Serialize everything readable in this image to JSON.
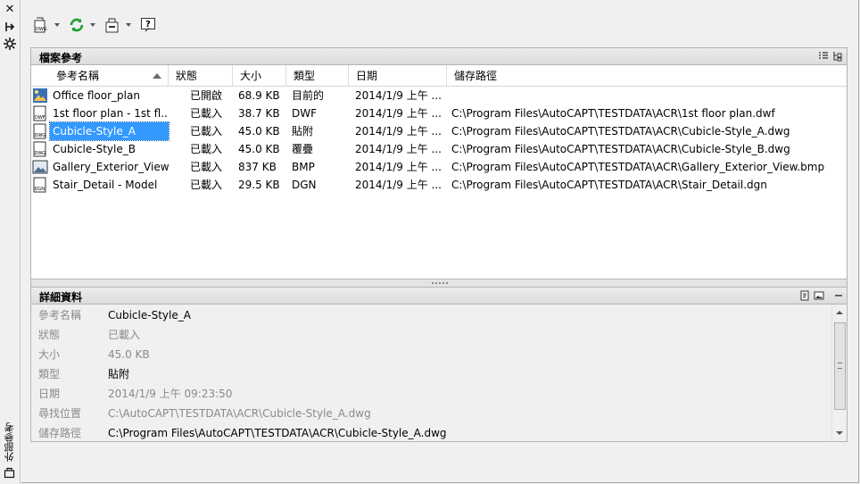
{
  "palette": {
    "title": "外部參考",
    "icons": [
      "close-icon",
      "autohide-icon",
      "properties-icon",
      "palette-menu-icon"
    ]
  },
  "toolbar": {
    "buttons": [
      {
        "name": "attach-dwg-button",
        "icon": "attach-dwg-icon",
        "label": "DWG"
      },
      {
        "name": "refresh-button",
        "icon": "refresh-icon"
      },
      {
        "name": "change-path-button",
        "icon": "change-path-icon"
      },
      {
        "name": "help-button",
        "icon": "help-icon"
      }
    ]
  },
  "file_refs": {
    "title": "檔案參考",
    "view_icons": [
      "list-view-icon",
      "tree-view-icon"
    ],
    "columns": [
      "參考名稱",
      "狀態",
      "大小",
      "類型",
      "日期",
      "儲存路徑"
    ],
    "sort_column": "參考名稱",
    "rows": [
      {
        "icon": "drawing-icon",
        "name": "Office floor_plan",
        "status": "已開啟",
        "size": "68.9 KB",
        "type": "目前的",
        "date": "2014/1/9 上午 ...",
        "path": ""
      },
      {
        "icon": "dwf-icon",
        "icon_label": "DWF",
        "name": "1st floor plan - 1st fl...",
        "status": "已載入",
        "size": "38.7 KB",
        "type": "DWF",
        "date": "2014/1/9 上午 ...",
        "path": "C:\\Program Files\\AutoCAPT\\TESTDATA\\ACR\\1st floor plan.dwf"
      },
      {
        "icon": "dwg-icon",
        "icon_label": "DWG",
        "name": "Cubicle-Style_A",
        "status": "已載入",
        "size": "45.0 KB",
        "type": "貼附",
        "date": "2014/1/9 上午 ...",
        "path": "C:\\Program Files\\AutoCAPT\\TESTDATA\\ACR\\Cubicle-Style_A.dwg",
        "selected": true
      },
      {
        "icon": "dwg-icon",
        "icon_label": "DWG",
        "name": "Cubicle-Style_B",
        "status": "已載入",
        "size": "45.0 KB",
        "type": "覆疊",
        "date": "2014/1/9 上午 ...",
        "path": "C:\\Program Files\\AutoCAPT\\TESTDATA\\ACR\\Cubicle-Style_B.dwg"
      },
      {
        "icon": "image-icon",
        "name": "Gallery_Exterior_View",
        "status": "已載入",
        "size": "837 KB",
        "type": "BMP",
        "date": "2014/1/9 上午 ...",
        "path": "C:\\Program Files\\AutoCAPT\\TESTDATA\\ACR\\Gallery_Exterior_View.bmp"
      },
      {
        "icon": "dgn-icon",
        "icon_label": "DGN",
        "name": "Stair_Detail - Model",
        "status": "已載入",
        "size": "29.5 KB",
        "type": "DGN",
        "date": "2014/1/9 上午 ...",
        "path": "C:\\Program Files\\AutoCAPT\\TESTDATA\\ACR\\Stair_Detail.dgn"
      }
    ]
  },
  "details": {
    "title": "詳細資料",
    "header_icons": [
      "details-view-icon",
      "preview-view-icon",
      "collapse-icon"
    ],
    "fields": [
      {
        "label": "參考名稱",
        "value": "Cubicle-Style_A",
        "dim": false
      },
      {
        "label": "狀態",
        "value": "已載入",
        "dim": true
      },
      {
        "label": "大小",
        "value": "45.0 KB",
        "dim": true
      },
      {
        "label": "類型",
        "value": "貼附",
        "dim": false
      },
      {
        "label": "日期",
        "value": "2014/1/9 上午 09:23:50",
        "dim": true
      },
      {
        "label": "尋找位置",
        "value": "C:\\AutoCAPT\\TESTDATA\\ACR\\Cubicle-Style_A.dwg",
        "dim": true
      },
      {
        "label": "儲存路徑",
        "value": "C:\\Program Files\\AutoCAPT\\TESTDATA\\ACR\\Cubicle-Style_A.dwg",
        "dim": false
      }
    ]
  },
  "colors": {
    "selection": "#3399ff",
    "refresh_green": "#1e9e2e"
  }
}
